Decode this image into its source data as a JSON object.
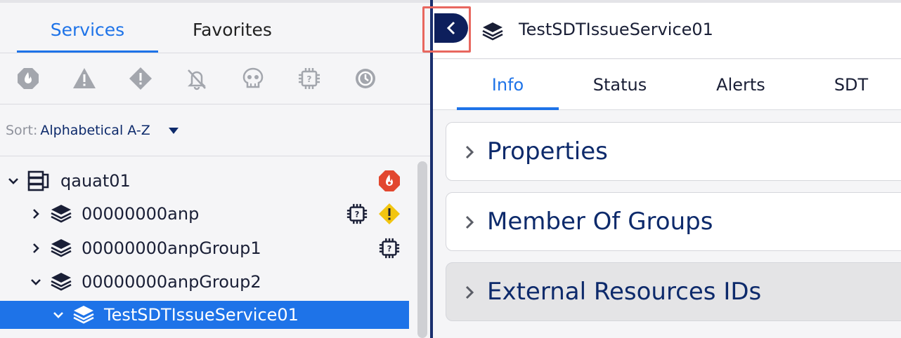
{
  "left_panel": {
    "tabs": [
      {
        "label": "Services",
        "active": true
      },
      {
        "label": "Favorites",
        "active": false
      }
    ],
    "filter_icons": [
      "critical-alert-icon",
      "error-alert-icon",
      "warning-alert-icon",
      "alert-muted-icon",
      "dead-icon",
      "no-data-icon",
      "sdt-icon"
    ],
    "sort": {
      "label": "Sort:",
      "value": "Alphabetical A-Z"
    },
    "tree": [
      {
        "label": "qauat01",
        "icon": "group-icon",
        "expanded": true,
        "badges": [
          "critical-alert-icon"
        ]
      },
      {
        "label": "00000000anp",
        "icon": "service-stack-icon",
        "expanded": false,
        "badges": [
          "no-data-icon",
          "warning-alert-icon"
        ]
      },
      {
        "label": "00000000anpGroup1",
        "icon": "service-stack-icon",
        "expanded": false,
        "badges": [
          "no-data-icon"
        ]
      },
      {
        "label": "00000000anpGroup2",
        "icon": "service-stack-icon",
        "expanded": true,
        "badges": []
      },
      {
        "label": "TestSDTIssueService01",
        "icon": "service-stack-icon",
        "expanded": true,
        "selected": true,
        "badges": []
      }
    ]
  },
  "right_panel": {
    "title": "TestSDTIssueService01",
    "tabs": [
      {
        "label": "Info",
        "active": true
      },
      {
        "label": "Status",
        "active": false
      },
      {
        "label": "Alerts",
        "active": false
      },
      {
        "label": "SDT",
        "active": false
      }
    ],
    "sections": [
      {
        "title": "Properties"
      },
      {
        "title": "Member Of Groups"
      },
      {
        "title": "External Resources IDs"
      }
    ]
  },
  "colors": {
    "accent": "#1e73e8",
    "navy": "#0d2a6b",
    "critical": "#e2472f",
    "warning": "#f2c511",
    "focus_ring": "#e8675f"
  }
}
